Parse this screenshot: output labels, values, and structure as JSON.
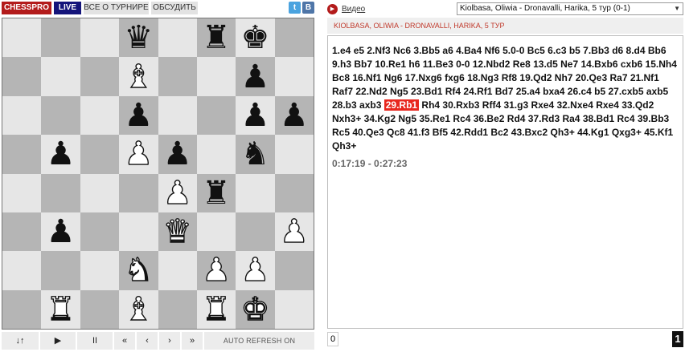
{
  "topbar": {
    "chesspro": "CHESSPRO",
    "live": "LIVE",
    "about": "ВСЕ О ТУРНИРЕ",
    "discuss": "ОБСУДИТЬ",
    "twitter_icon": "twitter-icon",
    "vk_icon": "vk-icon",
    "twitter_glyph": "t",
    "vk_glyph": "В"
  },
  "colors": {
    "brand_red": "#b31b1b",
    "live_navy": "#14147a",
    "highlight_move": "#e8271e",
    "light_square": "#e6e6e6",
    "dark_square": "#b5b5b5"
  },
  "board": {
    "orientation": "black-at-top",
    "ranks": [
      [
        "",
        "",
        "",
        "bK",
        "",
        "bR",
        "bK2",
        ""
      ],
      [
        "",
        "",
        "",
        "wB",
        "",
        "",
        "bP",
        ""
      ],
      [
        "",
        "",
        "",
        "bP",
        "",
        "",
        "bP",
        "bP"
      ],
      [
        "",
        "bP",
        "",
        "wP",
        "bP",
        "",
        "bN",
        ""
      ],
      [
        "",
        "",
        "",
        "",
        "wP",
        "bR",
        "",
        ""
      ],
      [
        "",
        "bP",
        "",
        "",
        "wQ",
        "",
        "",
        "wP"
      ],
      [
        "",
        "",
        "",
        "wN",
        "",
        "wP",
        "wP",
        ""
      ],
      [
        "",
        "wR",
        "",
        "wB",
        "",
        "wR",
        "wK",
        ""
      ]
    ],
    "pieces": [
      {
        "square": "d8",
        "piece": "black-queen-icon",
        "glyph": "♛",
        "color": "b"
      },
      {
        "square": "f8",
        "piece": "black-rook-icon",
        "glyph": "♜",
        "color": "b"
      },
      {
        "square": "g8",
        "piece": "black-king-icon",
        "glyph": "♚",
        "color": "b"
      },
      {
        "square": "d7",
        "piece": "white-bishop-icon",
        "glyph": "♝",
        "color": "w"
      },
      {
        "square": "g7",
        "piece": "black-pawn-icon",
        "glyph": "♟",
        "color": "b"
      },
      {
        "square": "d6",
        "piece": "black-pawn-icon",
        "glyph": "♟",
        "color": "b"
      },
      {
        "square": "g6",
        "piece": "black-pawn-icon",
        "glyph": "♟",
        "color": "b"
      },
      {
        "square": "h6",
        "piece": "black-pawn-icon",
        "glyph": "♟",
        "color": "b"
      },
      {
        "square": "b5",
        "piece": "black-pawn-icon",
        "glyph": "♟",
        "color": "b"
      },
      {
        "square": "d5",
        "piece": "white-pawn-icon",
        "glyph": "♟",
        "color": "w"
      },
      {
        "square": "e5",
        "piece": "black-pawn-icon",
        "glyph": "♟",
        "color": "b"
      },
      {
        "square": "g5",
        "piece": "black-knight-icon",
        "glyph": "♞",
        "color": "b"
      },
      {
        "square": "e4",
        "piece": "white-pawn-icon",
        "glyph": "♟",
        "color": "w"
      },
      {
        "square": "f4",
        "piece": "black-rook-icon",
        "glyph": "♜",
        "color": "b"
      },
      {
        "square": "b3",
        "piece": "black-pawn-icon",
        "glyph": "♟",
        "color": "b"
      },
      {
        "square": "e3",
        "piece": "white-queen-icon",
        "glyph": "♛",
        "color": "w"
      },
      {
        "square": "h3",
        "piece": "white-pawn-icon",
        "glyph": "♟",
        "color": "w"
      },
      {
        "square": "d2",
        "piece": "white-knight-icon",
        "glyph": "♞",
        "color": "w"
      },
      {
        "square": "f2",
        "piece": "white-pawn-icon",
        "glyph": "♟",
        "color": "w"
      },
      {
        "square": "g2",
        "piece": "white-pawn-icon",
        "glyph": "♟",
        "color": "w"
      },
      {
        "square": "b1",
        "piece": "white-rook-icon",
        "glyph": "♜",
        "color": "w"
      },
      {
        "square": "d1",
        "piece": "white-bishop-icon",
        "glyph": "♝",
        "color": "w"
      },
      {
        "square": "f1",
        "piece": "white-rook-icon",
        "glyph": "♜",
        "color": "w"
      },
      {
        "square": "g1",
        "piece": "white-king-icon",
        "glyph": "♚",
        "color": "w"
      }
    ]
  },
  "controls": {
    "flip": "↓↑",
    "play": "▶",
    "pause": "II",
    "first": "«",
    "prev": "‹",
    "next": "›",
    "last": "»",
    "auto_refresh": "AUTO REFRESH ON"
  },
  "right": {
    "video_icon": "play-circle-icon",
    "video_link": "Видео",
    "game_select": "Kiolbasa, Oliwia - Dronavalli, Harika, 5 тур (0-1)",
    "game_header": "KIOLBASA, OLIWIA - DRONAVALLI, HARIKA, 5 ТУР",
    "moves_before": "1.e4 e5 2.Nf3 Nc6 3.Bb5 a6 4.Ba4 Nf6 5.0-0 Bc5 6.c3 b5 7.Bb3 d6 8.d4 Bb6 9.h3 Bb7 10.Re1 h6 11.Be3 0-0 12.Nbd2 Re8 13.d5 Ne7 14.Bxb6 cxb6 15.Nh4 Bc8 16.Nf1 Ng6 17.Nxg6 fxg6 18.Ng3 Rf8 19.Qd2 Nh7 20.Qe3 Ra7 21.Nf1 Raf7 22.Nd2 Ng5 23.Bd1 Rf4 24.Rf1 Bd7 25.a4 bxa4 26.c4 b5 27.cxb5 axb5 28.b3 axb3",
    "moves_highlight": "29.Rb1",
    "moves_after": "Rh4 30.Rxb3 Rff4 31.g3 Rxe4 32.Nxe4 Rxe4 33.Qd2 Nxh3+ 34.Kg2 Ng5 35.Re1 Rc4 36.Be2 Rd4 37.Rd3 Ra4 38.Bd1 Rc4 39.Bb3 Rc5 40.Qe3 Qc8 41.f3 Bf5 42.Rdd1 Bc2 43.Bxc2 Qh3+ 44.Kg1 Qxg3+ 45.Kf1 Qh3+",
    "clock": "0:17:19 - 0:27:23",
    "counter_left": "0",
    "counter_right": "1"
  }
}
